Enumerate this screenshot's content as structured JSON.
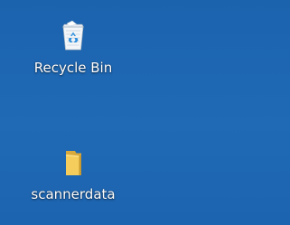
{
  "desktop": {
    "background_color": "#1f67b3",
    "icons": [
      {
        "label": "Recycle Bin",
        "icon": "recycle-bin-icon"
      },
      {
        "label": "scannerdata",
        "icon": "folder-icon"
      }
    ]
  }
}
